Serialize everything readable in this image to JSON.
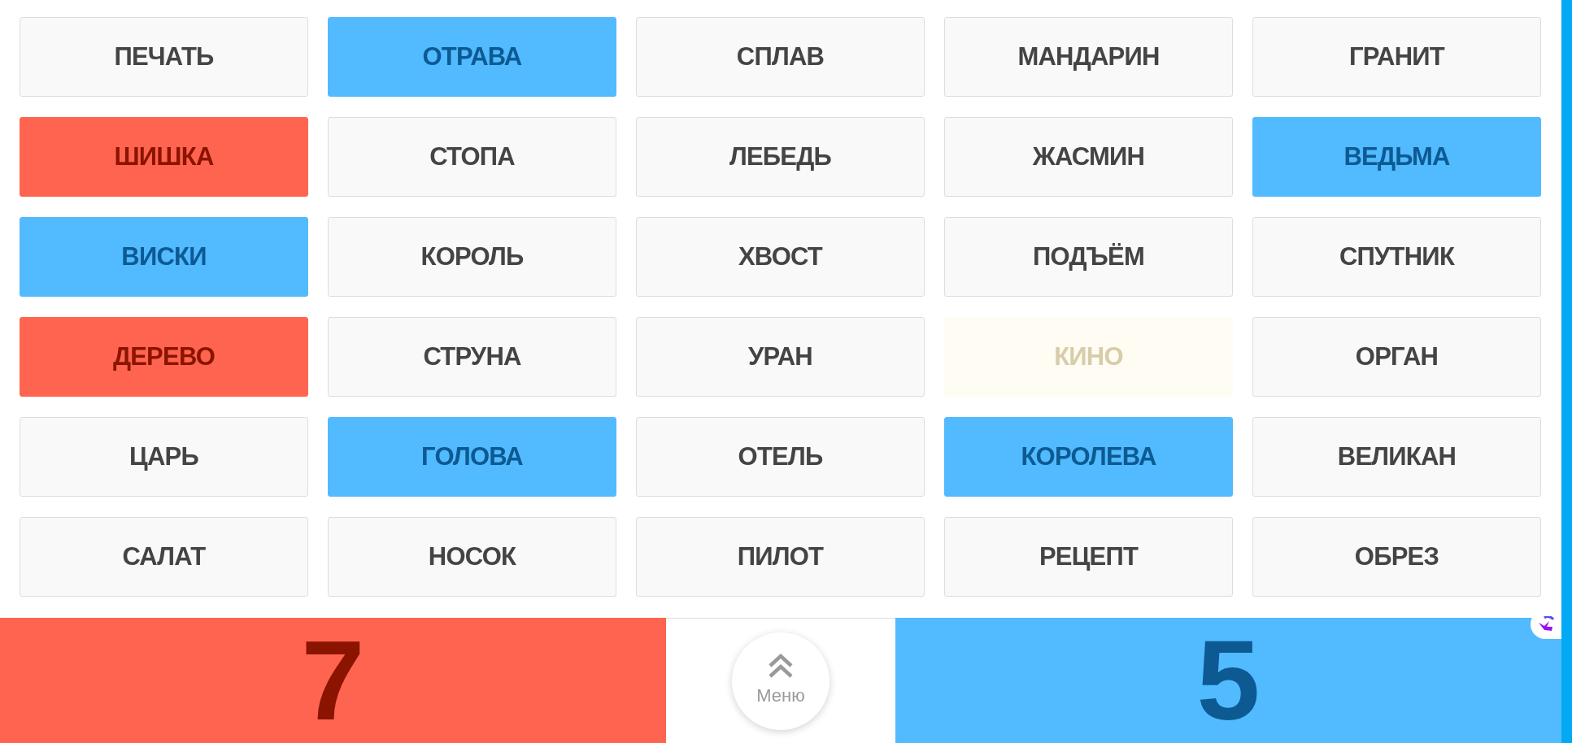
{
  "cards": [
    {
      "word": "ПЕЧАТЬ",
      "kind": "unrevealed"
    },
    {
      "word": "ОТРАВА",
      "kind": "blue"
    },
    {
      "word": "СПЛАВ",
      "kind": "unrevealed"
    },
    {
      "word": "МАНДАРИН",
      "kind": "unrevealed"
    },
    {
      "word": "ГРАНИТ",
      "kind": "unrevealed"
    },
    {
      "word": "ШИШКА",
      "kind": "red"
    },
    {
      "word": "СТОПА",
      "kind": "unrevealed"
    },
    {
      "word": "ЛЕБЕДЬ",
      "kind": "unrevealed"
    },
    {
      "word": "ЖАСМИН",
      "kind": "unrevealed"
    },
    {
      "word": "ВЕДЬМА",
      "kind": "blue"
    },
    {
      "word": "ВИСКИ",
      "kind": "blue"
    },
    {
      "word": "КОРОЛЬ",
      "kind": "unrevealed"
    },
    {
      "word": "ХВОСТ",
      "kind": "unrevealed"
    },
    {
      "word": "ПОДЪЁМ",
      "kind": "unrevealed"
    },
    {
      "word": "СПУТНИК",
      "kind": "unrevealed"
    },
    {
      "word": "ДЕРЕВО",
      "kind": "red"
    },
    {
      "word": "СТРУНА",
      "kind": "unrevealed"
    },
    {
      "word": "УРАН",
      "kind": "unrevealed"
    },
    {
      "word": "КИНО",
      "kind": "neutral"
    },
    {
      "word": "ОРГАН",
      "kind": "unrevealed"
    },
    {
      "word": "ЦАРЬ",
      "kind": "unrevealed"
    },
    {
      "word": "ГОЛОВА",
      "kind": "blue"
    },
    {
      "word": "ОТЕЛЬ",
      "kind": "unrevealed"
    },
    {
      "word": "КОРОЛЕВА",
      "kind": "blue"
    },
    {
      "word": "ВЕЛИКАН",
      "kind": "unrevealed"
    },
    {
      "word": "САЛАТ",
      "kind": "unrevealed"
    },
    {
      "word": "НОСОК",
      "kind": "unrevealed"
    },
    {
      "word": "ПИЛОТ",
      "kind": "unrevealed"
    },
    {
      "word": "РЕЦЕПТ",
      "kind": "unrevealed"
    },
    {
      "word": "ОБРЕЗ",
      "kind": "unrevealed"
    }
  ],
  "scores": [
    {
      "kind": "red",
      "value": "7"
    },
    {
      "kind": "blue",
      "value": "5"
    }
  ],
  "menu_button": {
    "label": "Меню"
  }
}
